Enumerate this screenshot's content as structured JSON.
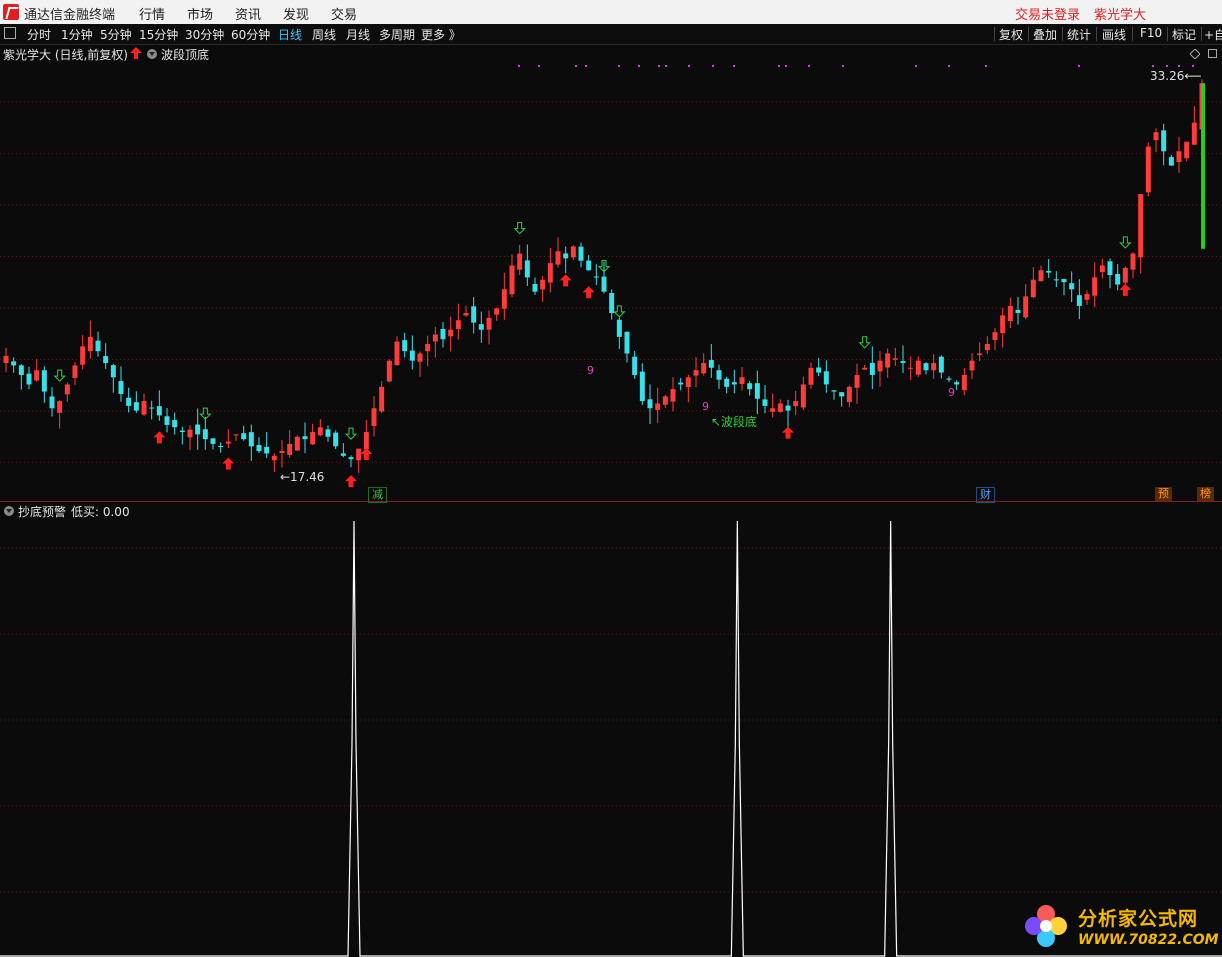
{
  "menubar": {
    "app_title": "通达信金融终端",
    "items": [
      "行情",
      "市场",
      "资讯",
      "发现",
      "交易"
    ],
    "login_status": "交易未登录",
    "user_label": "紫光学大"
  },
  "period_bar": {
    "periods": [
      "分时",
      "1分钟",
      "5分钟",
      "15分钟",
      "30分钟",
      "60分钟",
      "日线",
      "周线",
      "月线",
      "多周期",
      "更多 》"
    ],
    "active": "日线",
    "tools": [
      "复权",
      "叠加",
      "统计",
      "画线",
      "F10",
      "标记",
      "+自"
    ]
  },
  "main_pane": {
    "stock_title": "紫光学大 (日线,前复权)",
    "indicator_name": "波段顶底",
    "high_label": "33.26",
    "low_label": "17.46",
    "annotation": "波段底",
    "nine_label": "9",
    "event_tags": [
      {
        "text": "减",
        "color": "#2fc84a"
      },
      {
        "text": "财",
        "color": "#4aa8ff"
      },
      {
        "text": "预",
        "color": "#ff9a2a"
      },
      {
        "text": "榜",
        "color": "#ff9a2a"
      }
    ]
  },
  "sub_pane": {
    "indicator_name": "抄底预警",
    "value_label": "低买: 0.00"
  },
  "watermark": {
    "name": "分析家公式网",
    "url": "WWW.70822.COM"
  },
  "colors": {
    "up": "#ff3b3b",
    "down": "#38e0e8",
    "grid": "#5a1a1a",
    "buy_arrow": "#ff2020",
    "sell_arrow": "#30d040",
    "spike": "#ffffff"
  },
  "chart_data": [
    {
      "type": "candlestick",
      "series": [
        {
          "close": [
            21.8,
            21.4,
            21.0,
            20.6,
            21.2,
            20.3,
            19.6,
            19.9,
            20.6,
            21.4,
            22.2,
            22.6,
            22.0,
            21.5,
            20.9,
            20.2,
            19.7,
            19.5,
            19.9,
            19.6,
            19.3,
            18.9,
            18.8,
            18.6,
            18.7,
            18.5,
            18.3,
            18.1,
            18.0,
            18.2,
            18.5,
            18.3,
            18.0,
            17.8,
            17.7,
            17.6,
            17.8,
            18.1,
            18.4,
            18.3,
            18.6,
            18.8,
            18.4,
            18.0,
            17.6,
            17.46,
            17.9,
            18.6,
            19.6,
            20.5,
            21.6,
            22.4,
            22.0,
            21.6,
            21.9,
            22.3,
            22.7,
            22.5,
            22.9,
            23.3,
            23.6,
            23.2,
            22.9,
            23.4,
            23.8,
            24.6,
            25.6,
            26.1,
            25.1,
            24.5,
            25.0,
            25.7,
            26.2,
            25.9,
            26.4,
            25.8,
            25.4,
            25.1,
            24.5,
            23.6,
            22.6,
            21.9,
            21.0,
            19.9,
            19.6,
            19.8,
            20.1,
            20.4,
            20.6,
            20.9,
            21.2,
            21.5,
            21.3,
            20.8,
            20.5,
            20.6,
            20.9,
            20.4,
            20.0,
            19.7,
            19.6,
            19.8,
            19.5,
            19.9,
            20.6,
            21.3,
            21.1,
            20.6,
            20.3,
            20.1,
            20.5,
            21.0,
            21.3,
            21.0,
            21.6,
            21.9,
            21.7,
            21.5,
            21.3,
            21.6,
            21.2,
            21.5,
            21.1,
            20.8,
            20.6,
            21.0,
            21.6,
            21.9,
            22.3,
            22.8,
            23.5,
            23.9,
            23.6,
            24.3,
            25.0,
            25.4,
            25.3,
            25.0,
            24.9,
            24.6,
            23.9,
            24.4,
            25.1,
            25.6,
            25.2,
            24.8,
            25.5,
            26.1,
            28.6,
            30.6,
            31.2,
            30.4,
            29.8,
            30.4,
            30.8,
            31.6,
            33.26
          ],
          "up_marks": [
            "红色实体为阳线"
          ],
          "down_marks": [
            "青色实体为阴线"
          ]
        }
      ],
      "price_range": [
        16.5,
        33.9
      ],
      "annotations": {
        "high": 33.26,
        "low": 17.46
      }
    },
    {
      "type": "line",
      "series": [
        {
          "name": "低买",
          "spikes_at_bar": [
            45,
            95,
            115
          ],
          "values_note": "0 everywhere except spikes to 1"
        }
      ]
    }
  ]
}
